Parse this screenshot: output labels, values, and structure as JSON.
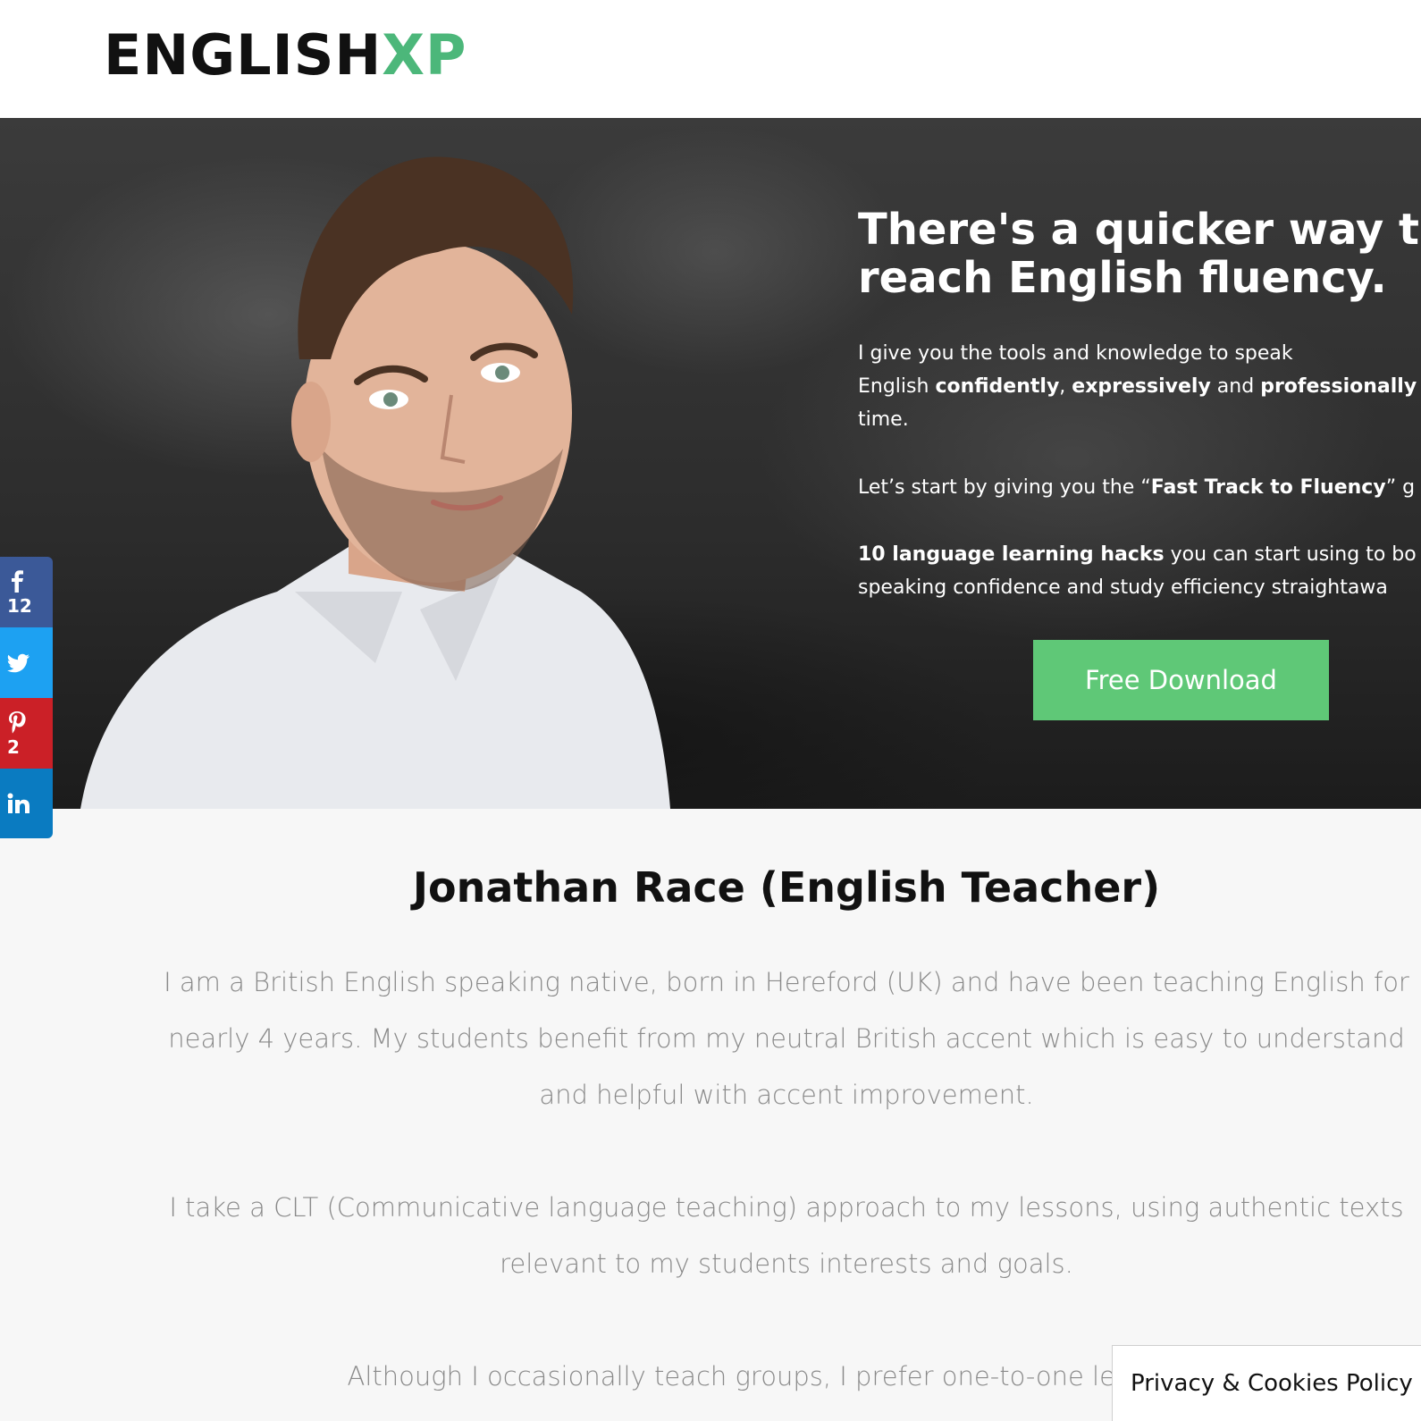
{
  "header": {
    "logo_main": "ENGLISH",
    "logo_accent": "XP",
    "accent_color": "#4cb77a"
  },
  "hero": {
    "title_line1": "There's a quicker way to",
    "title_line2": "reach English fluency.",
    "p1": {
      "line1": "I give you the tools and knowledge to speak",
      "l2a": "English ",
      "l2b": "confidently",
      "l2c": ", ",
      "l2d": "expressively",
      "l2e": " and ",
      "l2f": "professionally",
      "line3": "time."
    },
    "p2": {
      "a": "Let’s start by giving you the “",
      "b": "Fast Track to Fluency",
      "c": "” g"
    },
    "p3": {
      "a": "10 language learning hacks",
      "b": " you can start using to bo",
      "line2": "speaking confidence and study efficiency straightawa"
    },
    "cta_label": "Free Download",
    "cta_color": "#5fc877"
  },
  "share": {
    "facebook": {
      "icon": "facebook-icon",
      "count": "12"
    },
    "twitter": {
      "icon": "twitter-icon"
    },
    "pinterest": {
      "icon": "pinterest-icon",
      "count": "2"
    },
    "linkedin": {
      "icon": "linkedin-icon"
    }
  },
  "content": {
    "title": "Jonathan Race (English Teacher)",
    "para1": "I am a British English speaking native, born in Hereford (UK) and have been teaching English for nearly 4 years. My students benefit from my neutral British accent which is easy to understand and helpful with accent improvement.",
    "para2": "I take a CLT (Communicative language teaching) approach to my lessons, using authentic texts relevant to my students interests and goals.",
    "para3": "Although I occasionally teach groups, I prefer one-to-one lessons as"
  },
  "privacy_label": "Privacy & Cookies Policy"
}
